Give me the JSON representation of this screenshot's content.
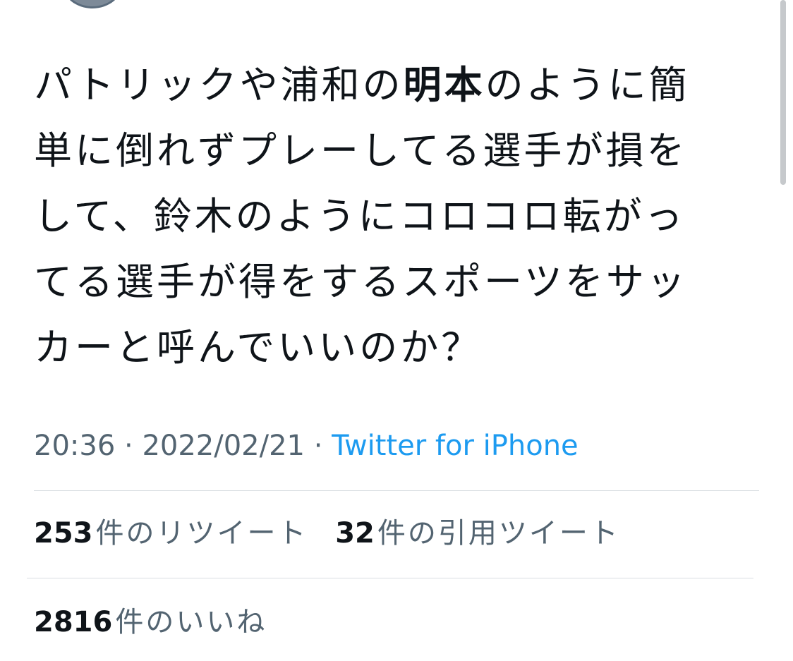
{
  "tweet": {
    "text_lines": [
      {
        "before": "パトリックや浦和の",
        "bold": "明本",
        "after": "のように簡"
      },
      {
        "before": "単に倒れずプレーしてる選手が損を",
        "bold": "",
        "after": ""
      },
      {
        "before": "して、鈴木のようにコロコロ転がっ",
        "bold": "",
        "after": ""
      },
      {
        "before": "てる選手が得をするスポーツをサッ",
        "bold": "",
        "after": ""
      },
      {
        "before": "カーと呼んでいいのか？",
        "bold": "",
        "after": ""
      }
    ],
    "time": "20:36",
    "separator": "·",
    "date": "2022/02/21",
    "source": "Twitter for iPhone"
  },
  "stats": {
    "retweets": {
      "count": "253",
      "label": "件のリツイート"
    },
    "quotes": {
      "count": "32",
      "label": "件の引用ツイート"
    },
    "likes": {
      "count": "2816",
      "label": "件のいいね"
    }
  }
}
